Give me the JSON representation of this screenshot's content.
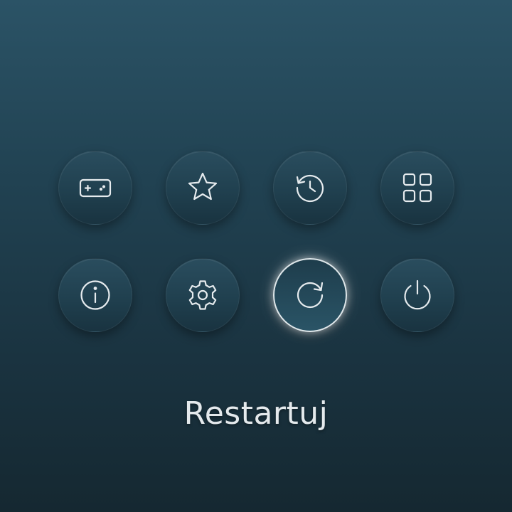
{
  "menu": {
    "buttons": [
      {
        "icon": "gamepad-icon"
      },
      {
        "icon": "star-icon"
      },
      {
        "icon": "history-icon"
      },
      {
        "icon": "grid-icon"
      },
      {
        "icon": "info-icon"
      },
      {
        "icon": "settings-icon"
      },
      {
        "icon": "restart-icon",
        "selected": true
      },
      {
        "icon": "power-icon"
      }
    ],
    "selected_label": "Restartuj"
  },
  "colors": {
    "background_top": "#2b5366",
    "background_bottom": "#152831",
    "icon_stroke": "#e6ebee",
    "selected_ring": "#dfe7ea"
  }
}
